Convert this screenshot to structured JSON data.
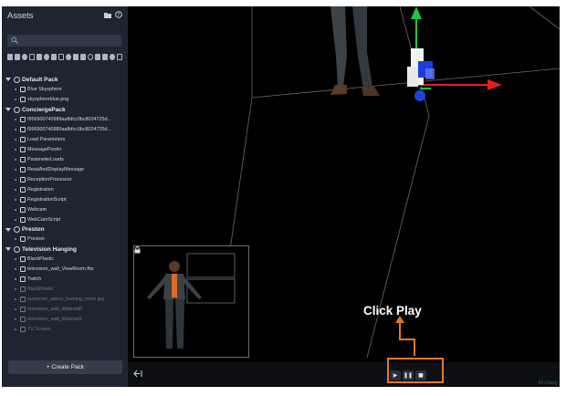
{
  "sidebar": {
    "title": "Assets",
    "search_placeholder": "",
    "header_icons": [
      "folder-icon",
      "help-icon"
    ],
    "toolbar_icons": [
      "filter-all-icon",
      "filter-audio-icon",
      "filter-script-icon",
      "filter-entity-icon",
      "filter-material-icon",
      "filter-mesh-icon",
      "filter-animation-icon",
      "filter-light-icon",
      "filter-sound-icon",
      "filter-texture-icon",
      "filter-skybox-icon",
      "filter-camera-icon",
      "filter-shape-icon",
      "filter-environment-icon",
      "filter-timeline-icon",
      "filter-state-icon"
    ],
    "tree": [
      {
        "kind": "pack",
        "label": "Default Pack"
      },
      {
        "kind": "item",
        "label": "Blue Skysphere",
        "dim": false
      },
      {
        "kind": "item",
        "label": "skysphereblue.png",
        "dim": false
      },
      {
        "kind": "pack",
        "label": "ConciergePack"
      },
      {
        "kind": "item",
        "label": "f956900740989aafbfcc0bc8024725d...",
        "dim": false
      },
      {
        "kind": "item",
        "label": "f956900740989aafbfcc0bc8024725d...",
        "dim": false
      },
      {
        "kind": "item",
        "label": "Load Parameters",
        "dim": false
      },
      {
        "kind": "item",
        "label": "MessagePooler",
        "dim": false
      },
      {
        "kind": "item",
        "label": "ParameterLoads",
        "dim": false
      },
      {
        "kind": "item",
        "label": "ReadAndDisplayMessage",
        "dim": false
      },
      {
        "kind": "item",
        "label": "ReceptionProcessor",
        "dim": false
      },
      {
        "kind": "item",
        "label": "Registration",
        "dim": false
      },
      {
        "kind": "item",
        "label": "RegistrationScript",
        "dim": false
      },
      {
        "kind": "item",
        "label": "Webcam",
        "dim": false
      },
      {
        "kind": "item",
        "label": "WebCamScript",
        "dim": false
      },
      {
        "kind": "pack",
        "label": "Preston"
      },
      {
        "kind": "item",
        "label": "Preston",
        "dim": false
      },
      {
        "kind": "pack",
        "label": "Television Hanging"
      },
      {
        "kind": "item",
        "label": "BlackPlastic",
        "dim": false
      },
      {
        "kind": "item",
        "label": "television_wall_ViewRoom.fbx",
        "dim": false
      },
      {
        "kind": "item",
        "label": "Twitch",
        "dim": false
      },
      {
        "kind": "item",
        "label": "BlackPlastic",
        "dim": true
      },
      {
        "kind": "item",
        "label": "sumerian_specs_training_room.jpg",
        "dim": true
      },
      {
        "kind": "item",
        "label": "television_wall_Material0",
        "dim": true
      },
      {
        "kind": "item",
        "label": "television_wall_Material1",
        "dim": true
      },
      {
        "kind": "item",
        "label": "TV Screen",
        "dim": true
      }
    ],
    "create_button": "+ Create Pack"
  },
  "viewport": {
    "controls": [
      {
        "name": "play-button",
        "glyph": "▶"
      },
      {
        "name": "pause-button",
        "glyph": "❚❚"
      },
      {
        "name": "stop-button",
        "glyph": "■"
      }
    ]
  },
  "annotation": {
    "label": "Click Play",
    "color": "#e87722"
  },
  "status_text": "All Chang"
}
